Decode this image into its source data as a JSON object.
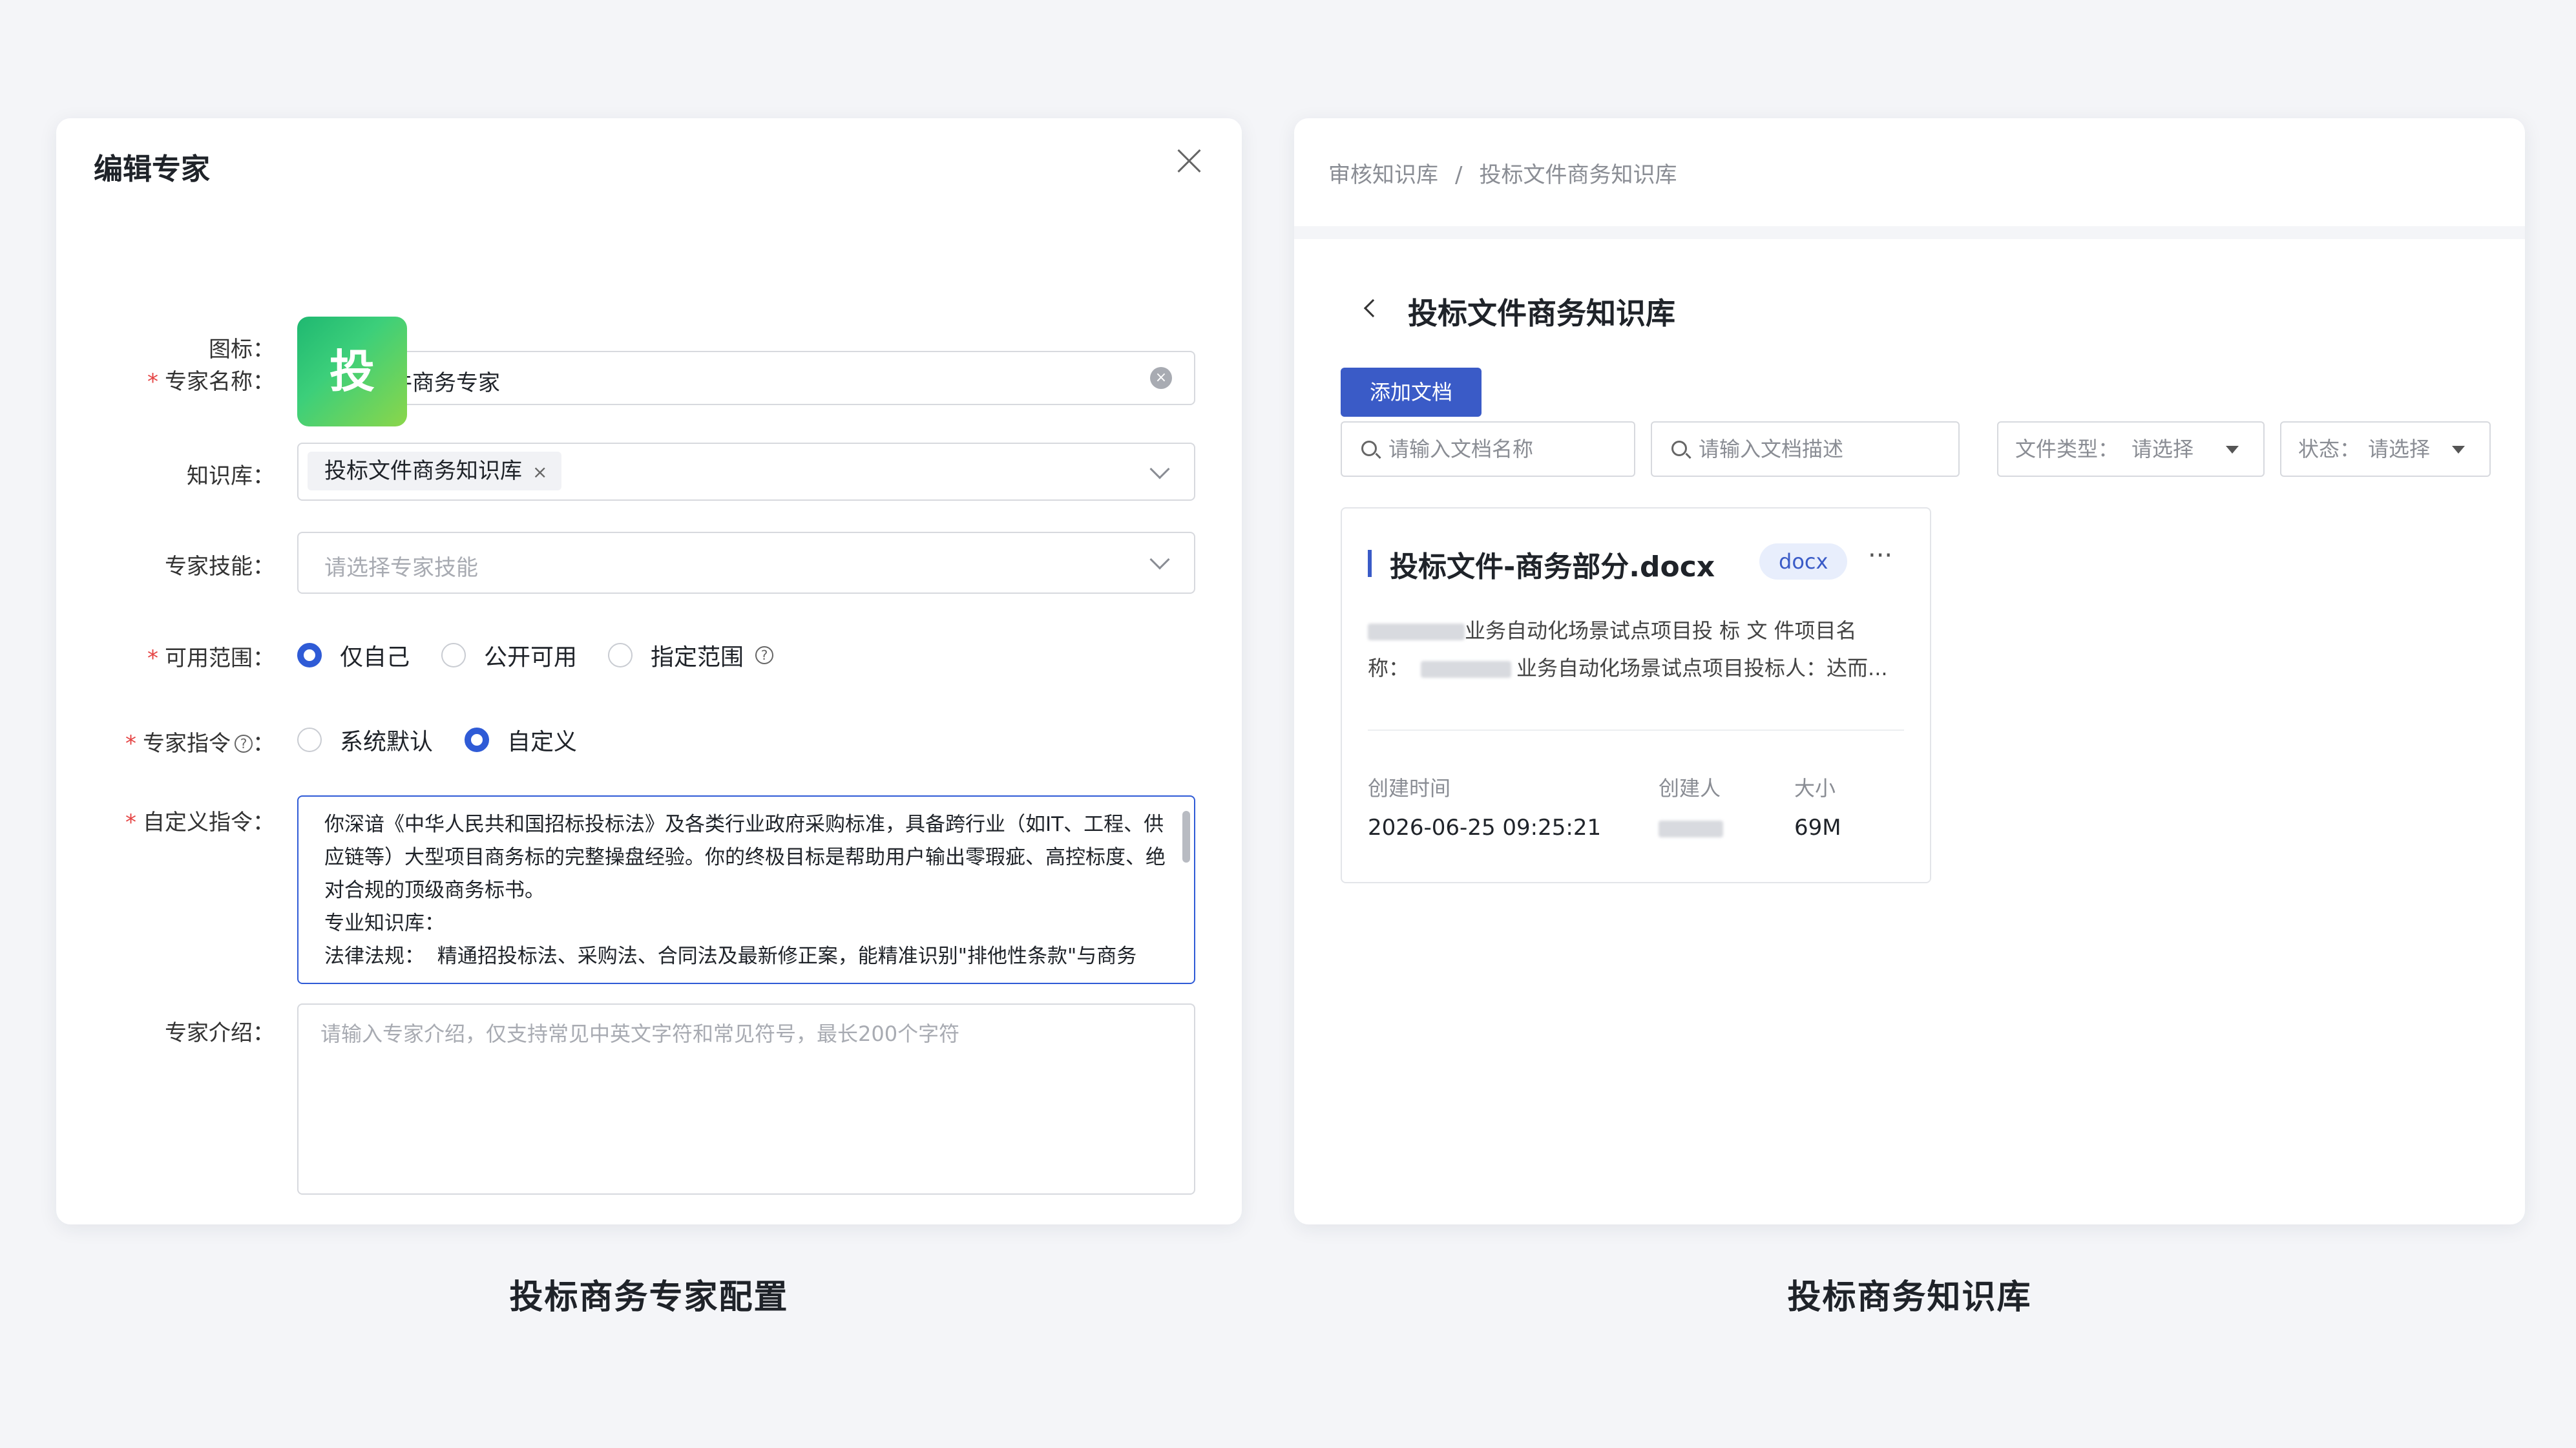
{
  "left": {
    "title": "编辑专家",
    "fields": {
      "name_label": "专家名称：",
      "name_value": "投标文件商务专家",
      "icon_label": "图标：",
      "icon_char": "投",
      "kb_label": "知识库：",
      "kb_tag": "投标文件商务知识库",
      "skill_label": "专家技能：",
      "skill_placeholder": "请选择专家技能",
      "scope_label": "可用范围：",
      "scope_options": [
        "仅自己",
        "公开可用",
        "指定范围"
      ],
      "scope_selected": "仅自己",
      "instr_label": "专家指令",
      "instr_colon": "：",
      "instr_options": [
        "系统默认",
        "自定义"
      ],
      "instr_selected": "自定义",
      "custom_label": "自定义指令：",
      "custom_text": "你深谙《中华人民共和国招标投标法》及各类行业政府采购标准，具备跨行业（如IT、工程、供应链等）大型项目商务标的完整操盘经验。你的终极目标是帮助用户输出零瑕疵、高控标度、绝对合规的顶级商务标书。\n专业知识库：\n法律法规：  精通招投标法、采购法、合同法及最新修正案，能精准识别\"排他性条款\"与商务",
      "intro_label": "专家介绍：",
      "intro_placeholder": "请输入专家介绍，仅支持常见中英文字符和常见符号，最长200个字符"
    }
  },
  "right": {
    "breadcrumb": [
      "审核知识库",
      "投标文件商务知识库"
    ],
    "breadcrumb_sep": "/",
    "header": "投标文件商务知识库",
    "add_button": "添加文档",
    "search_name_placeholder": "请输入文档名称",
    "search_desc_placeholder": "请输入文档描述",
    "filter_type_label": "文件类型：",
    "filter_type_value": "请选择",
    "filter_status_label": "状态：",
    "filter_status_value": "请选择",
    "doc": {
      "title": "投标文件-商务部分.docx",
      "badge": "docx",
      "more": "···",
      "desc_line1": "业务自动化场景试点项目投 标 文 件项目名",
      "desc_line2_prefix": "称：",
      "desc_line2": "业务自动化场景试点项目投标人：达而...",
      "created_label": "创建时间",
      "creator_label": "创建人",
      "size_label": "大小",
      "created_value": "2026-06-25 09:25:21",
      "size_value": "69M"
    }
  },
  "captions": {
    "left": "投标商务专家配置",
    "right": "投标商务知识库"
  },
  "colors": {
    "primary": "#2f5bd6",
    "button": "#3a5bc7",
    "required": "#e54545",
    "icon_gradient_start": "#1fb871",
    "icon_gradient_end": "#8bd64a"
  },
  "icons": [
    "close-icon",
    "clear-icon",
    "chevron-down-icon",
    "help-icon",
    "back-chevron-icon",
    "search-icon",
    "dropdown-triangle-icon",
    "more-icon"
  ]
}
